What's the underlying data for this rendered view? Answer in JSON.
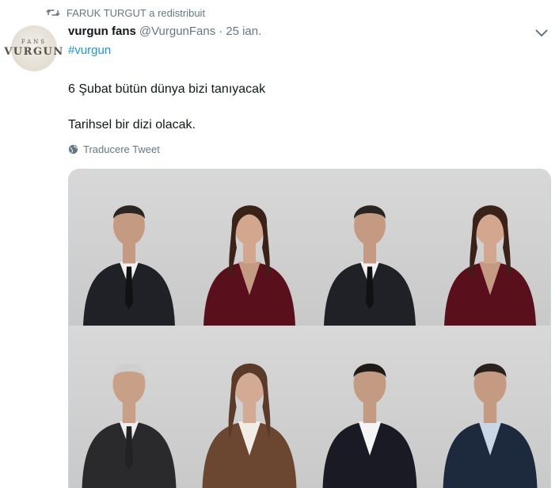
{
  "retweet": {
    "text": "FARUK TURGUT a redistribuit"
  },
  "avatar": {
    "line1": "FANS",
    "line2": "VURGUN"
  },
  "author": {
    "name": "vurgun fans",
    "handle": "@VurgunFans",
    "separator": "·",
    "date": "25 ian."
  },
  "tweet": {
    "hashtag": "#vurgun",
    "paragraphs": [
      "6 Şubat bütün dünya bizi tanıyacak",
      "Tarihsel bir dizi olacak."
    ]
  },
  "translate": {
    "label": "Traducere Tweet"
  },
  "colors": {
    "link": "#1b95e0",
    "secondary": "#657786",
    "text": "#14171a"
  },
  "media": {
    "photos": [
      {
        "kind": "man-suit"
      },
      {
        "kind": "woman-red-dress"
      },
      {
        "kind": "man-suit"
      },
      {
        "kind": "woman-red-dress"
      },
      {
        "kind": "older-man-suit"
      },
      {
        "kind": "woman-brown-coat"
      },
      {
        "kind": "man-velvet-jacket"
      },
      {
        "kind": "man-navy-suit"
      }
    ]
  }
}
